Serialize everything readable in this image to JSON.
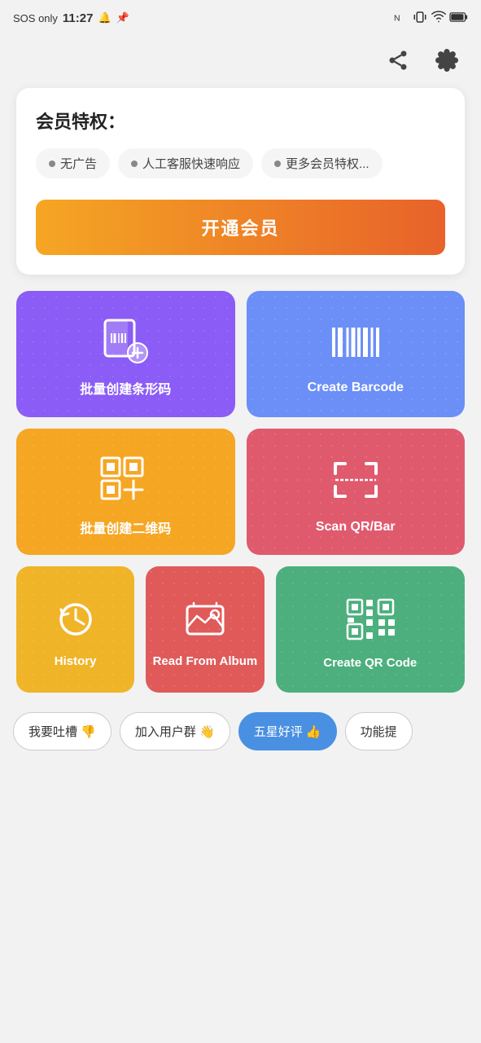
{
  "statusBar": {
    "left": "SOS only",
    "time": "11:27",
    "bellIcon": "🔔",
    "pinIcon": "📌"
  },
  "topActions": {
    "shareLabel": "share",
    "settingsLabel": "settings"
  },
  "memberCard": {
    "title": "会员特权：",
    "perks": [
      {
        "label": "无广告"
      },
      {
        "label": "人工客服快速响应"
      },
      {
        "label": "更多会员特权..."
      }
    ],
    "buttonLabel": "开通会员"
  },
  "gridCards": [
    {
      "id": "batch-barcode",
      "label": "批量创建条形码",
      "color": "purple"
    },
    {
      "id": "create-barcode",
      "label": "Create Barcode",
      "color": "blue"
    },
    {
      "id": "batch-qr",
      "label": "批量创建二维码",
      "color": "orange"
    },
    {
      "id": "scan-qr",
      "label": "Scan QR/Bar",
      "color": "red"
    }
  ],
  "bottomCards": [
    {
      "id": "history",
      "label": "History",
      "color": "yellow"
    },
    {
      "id": "read-album",
      "label": "Read From Album",
      "color": "pink"
    },
    {
      "id": "create-qr",
      "label": "Create QR Code",
      "color": "green"
    }
  ],
  "bottomButtons": [
    {
      "id": "complain",
      "label": "我要吐槽 👎",
      "active": false
    },
    {
      "id": "join-group",
      "label": "加入用户群 👋",
      "active": false
    },
    {
      "id": "five-star",
      "label": "五星好评 👍",
      "active": true
    },
    {
      "id": "feature",
      "label": "功能提",
      "active": false
    }
  ]
}
